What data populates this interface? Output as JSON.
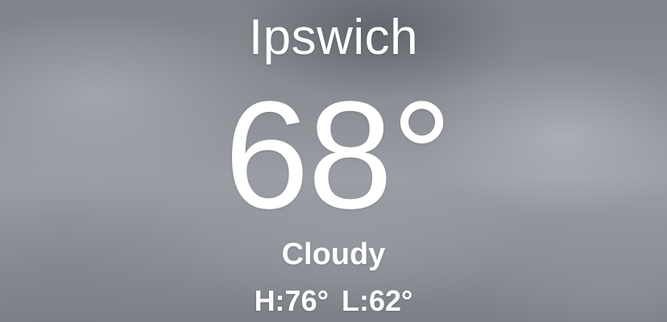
{
  "weather": {
    "city": "Ipswich",
    "temperature": "68°",
    "condition": "Cloudy",
    "high": "H:76°",
    "low": "L:62°"
  },
  "background": {
    "sky": "overcast-clouds",
    "base_color": "#8d9197"
  }
}
